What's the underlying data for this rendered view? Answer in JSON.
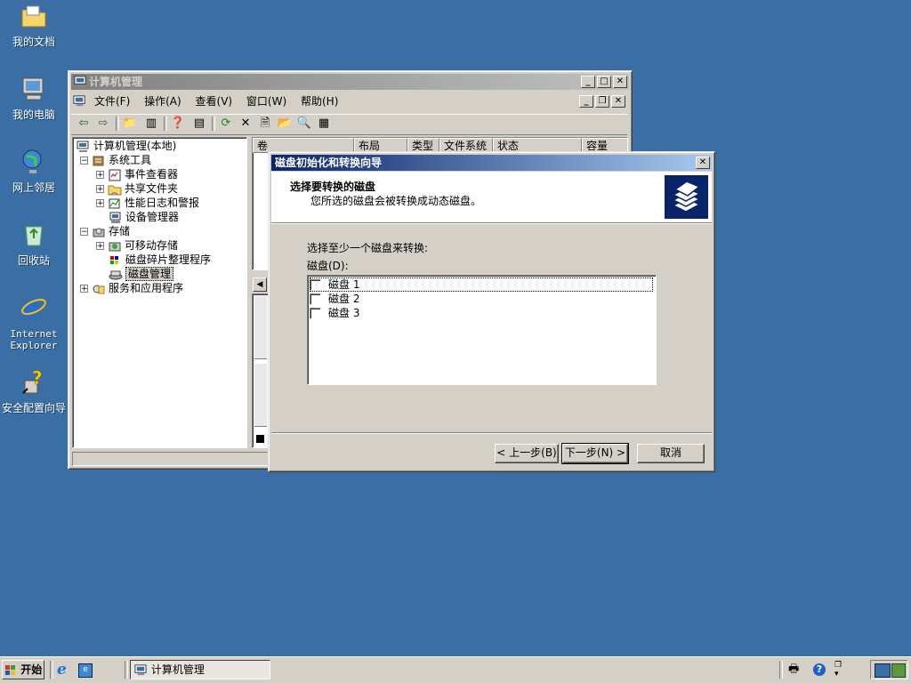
{
  "desktop": {
    "icons": [
      {
        "label": "我的文档"
      },
      {
        "label": "我的电脑"
      },
      {
        "label": "网上邻居"
      },
      {
        "label": "回收站"
      },
      {
        "label": "Internet Explorer"
      },
      {
        "label": "安全配置向导"
      }
    ]
  },
  "mainWindow": {
    "title": "计算机管理",
    "menu": [
      "文件(F)",
      "操作(A)",
      "查看(V)",
      "窗口(W)",
      "帮助(H)"
    ],
    "tree": [
      {
        "label": "计算机管理(本地)"
      },
      {
        "label": "系统工具"
      },
      {
        "label": "事件查看器"
      },
      {
        "label": "共享文件夹"
      },
      {
        "label": "性能日志和警报"
      },
      {
        "label": "设备管理器"
      },
      {
        "label": "存储"
      },
      {
        "label": "可移动存储"
      },
      {
        "label": "磁盘碎片整理程序"
      },
      {
        "label": "磁盘管理"
      },
      {
        "label": "服务和应用程序"
      }
    ],
    "columns": [
      "卷",
      "布局",
      "类型",
      "文件系统",
      "状态",
      "容量"
    ]
  },
  "wizard": {
    "title": "磁盘初始化和转换向导",
    "header_title": "选择要转换的磁盘",
    "header_subtitle": "您所选的磁盘会被转换成动态磁盘。",
    "instruction": "选择至少一个磁盘来转换:",
    "list_label": "磁盘(D):",
    "disks": [
      {
        "label": "磁盘 1",
        "checked": false
      },
      {
        "label": "磁盘 2",
        "checked": false
      },
      {
        "label": "磁盘 3",
        "checked": false
      }
    ],
    "back_button": "< 上一步(B)",
    "next_button": "下一步(N) >",
    "cancel_button": "取消"
  },
  "taskbar": {
    "start_label": "开始",
    "task_label": "计算机管理"
  }
}
